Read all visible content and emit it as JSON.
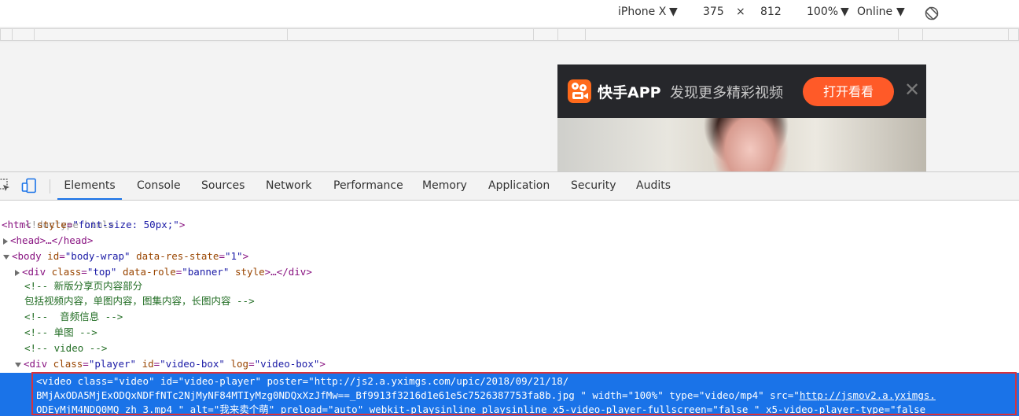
{
  "device_toolbar": {
    "model": "iPhone X",
    "width": "375",
    "times": "×",
    "height": "812",
    "zoom": "100%",
    "throttle": "Online",
    "arrow": "▼"
  },
  "banner": {
    "app_name": "快手APP",
    "slogan": "发现更多精彩视频",
    "open_button": "打开看看",
    "close": "✕"
  },
  "devtools": {
    "tabs": [
      "Elements",
      "Console",
      "Sources",
      "Network",
      "Performance",
      "Memory",
      "Application",
      "Security",
      "Audits"
    ],
    "active_tab": "Elements"
  },
  "dom": {
    "doctype": "<!doctype html>",
    "html_open": "<html",
    "html_attr": "style",
    "html_val": "\"font-size: 50px;\"",
    "head": "<head>…</head>",
    "body_tag": "<body",
    "body_attr1": "id",
    "body_val1": "\"body-wrap\"",
    "body_attr2": "data-res-state",
    "body_val2": "\"1\"",
    "div_top_tag": "<div",
    "div_top_attr1": "class",
    "div_top_val1": "\"top\"",
    "div_top_attr2": "data-role",
    "div_top_val2": "\"banner\"",
    "div_top_attr3": "style",
    "div_top_tail": ">…</div>",
    "comment1a": "<!-- 新版分享页内容部分",
    "comment1b": "包括视频内容，单图内容，图集内容，长图内容 -->",
    "comment2": "<!--  音频信息 -->",
    "comment3": "<!-- 单图 -->",
    "comment4": "<!-- video -->",
    "div_player_tag": "<div",
    "div_player_attr1": "class",
    "div_player_val1": "\"player\"",
    "div_player_attr2": "id",
    "div_player_val2": "\"video-box\"",
    "div_player_attr3": "log",
    "div_player_val3": "\"video-box\"",
    "video_line1": "<video class=\"video\" id=\"video-player\" poster=\"http://js2.a.yximgs.com/upic/2018/09/21/18/",
    "video_line2a": "BMjAxODA5MjExODQxNDFfNTc2NjMyNF84MTIyMzg0NDQxXzJfMw==_Bf9913f3216d1e61e5c7526387753fa8b.jpg \" width=\"100%\" type=\"video/mp4\" src=\"",
    "video_line2b": "http://jsmov2.a.yximgs.",
    "video_line3a": "ODEyMjM4NDQ0MQ_zh_3.mp4 ",
    "video_line3b": "\" alt=\"我来卖个萌\" preload=\"auto\" webkit-playsinline playsinline x5-video-player-fullscreen=\"false \" x5-video-player-type=\"false"
  },
  "icons": {
    "rotate": "rotate-icon",
    "inspect": "inspect-element-icon",
    "device": "device-toggle-icon",
    "logo": "kuaishou-logo-icon",
    "close": "close-icon",
    "triangle_right": "expand-triangle-icon",
    "triangle_down": "collapse-triangle-icon"
  },
  "colors": {
    "accent": "#1a73e8",
    "open_button": "#ff5a28",
    "logo": "#ff6a1b",
    "banner_bg": "#26272b",
    "selection_border": "#d8323c"
  }
}
